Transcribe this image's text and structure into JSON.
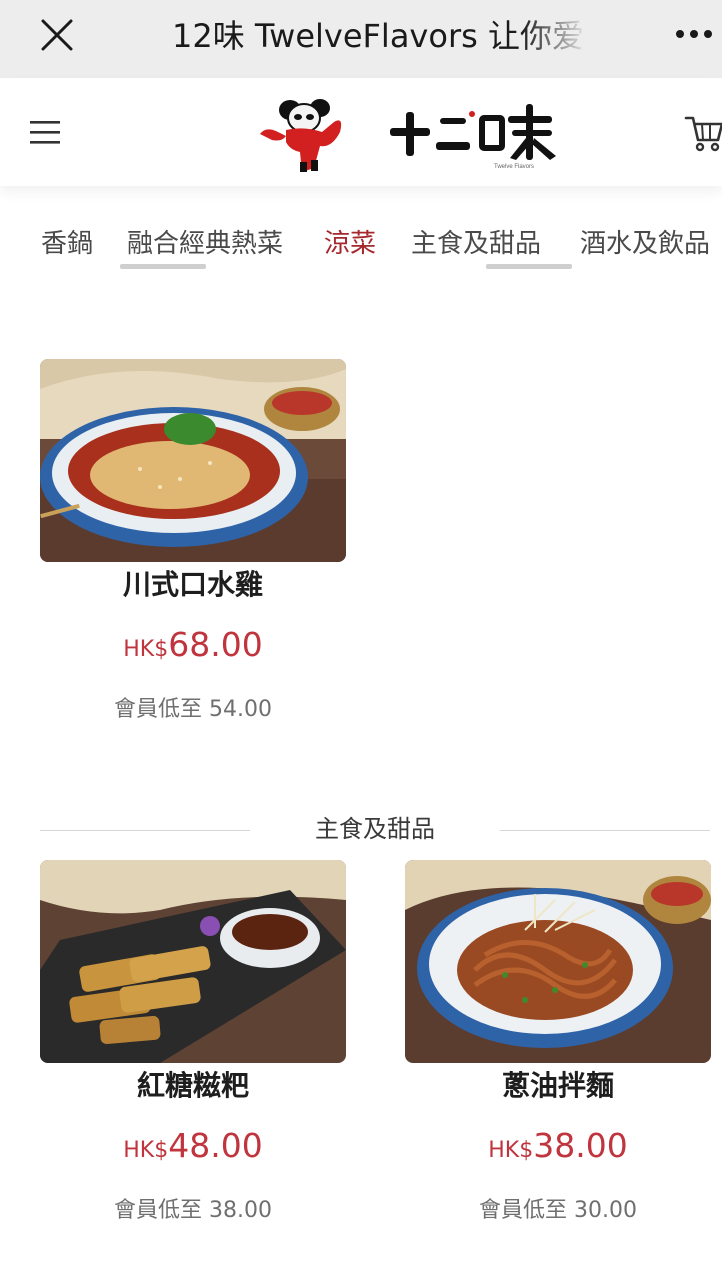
{
  "browser_bar": {
    "title": "12味 TwelveFlavors 让你爱"
  },
  "header": {
    "logo_text": "十二味"
  },
  "tabs": [
    {
      "label": "香鍋",
      "active": false
    },
    {
      "label": "融合經典熱菜",
      "active": false
    },
    {
      "label": "涼菜",
      "active": true
    },
    {
      "label": "主食及甜品",
      "active": false
    },
    {
      "label": "酒水及飲品",
      "active": false
    }
  ],
  "section_title": "主食及甜品",
  "products": [
    {
      "name": "川式口水雞",
      "currency": "HK$",
      "price": "68.00",
      "member_price": "會員低至 54.00"
    },
    {
      "name": "紅糖糍粑",
      "currency": "HK$",
      "price": "48.00",
      "member_price": "會員低至 38.00"
    },
    {
      "name": "蔥油拌麵",
      "currency": "HK$",
      "price": "38.00",
      "member_price": "會員低至 30.00"
    }
  ],
  "colors": {
    "accent": "#a4282c",
    "price": "#c0353d",
    "topbar": "#ededed"
  }
}
